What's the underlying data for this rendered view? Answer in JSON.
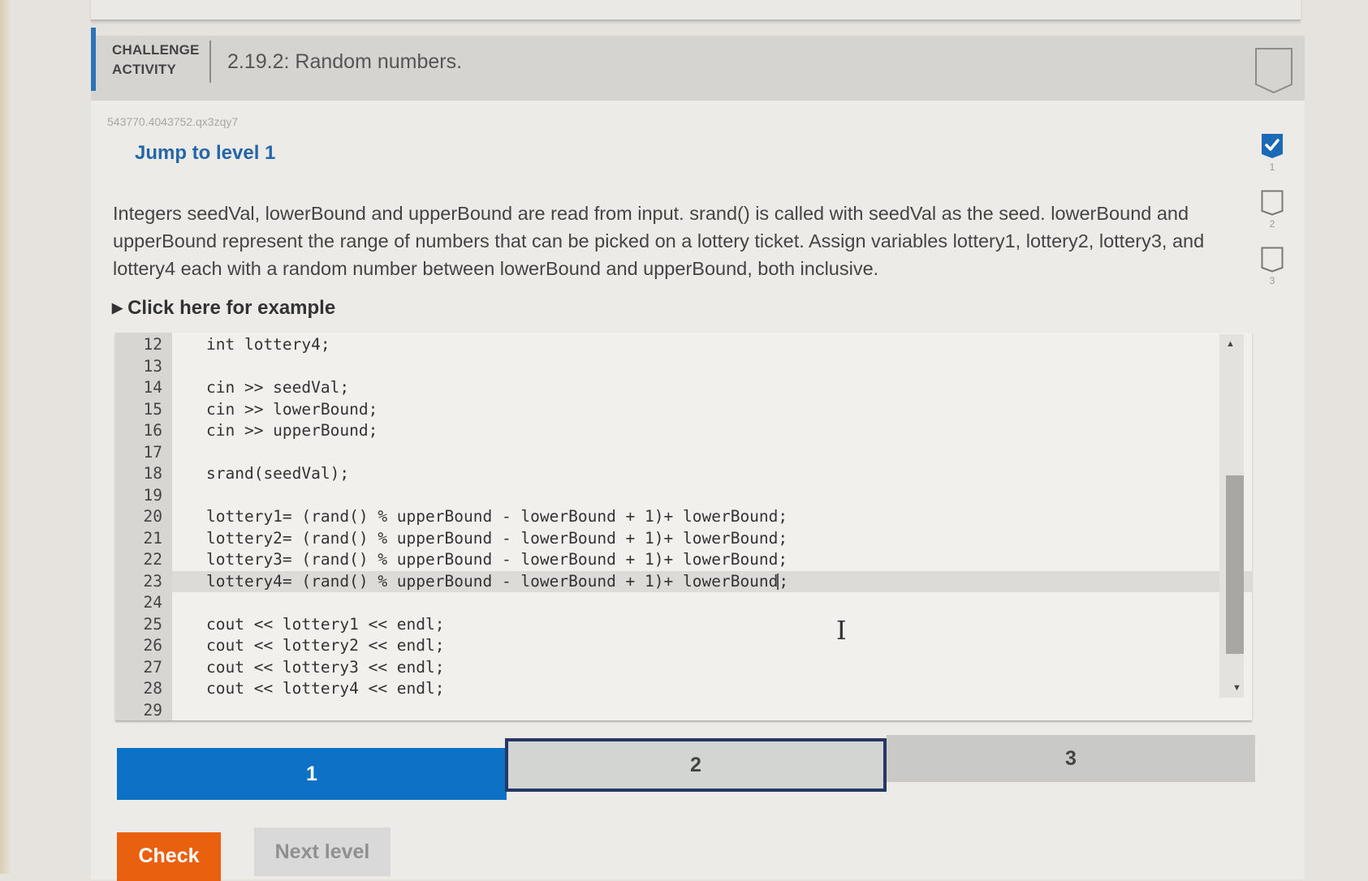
{
  "header": {
    "kind_line1": "CHALLENGE",
    "kind_line2": "ACTIVITY",
    "title": "2.19.2: Random numbers."
  },
  "activity_id": "543770.4043752.qx3zqy7",
  "jump_link": "Jump to level 1",
  "instructions": "Integers seedVal, lowerBound and upperBound are read from input. srand() is called with seedVal as the seed. lowerBound and upperBound represent the range of numbers that can be picked on a lottery ticket. Assign variables lottery1, lottery2, lottery3, and lottery4 each with a random number between lowerBound and upperBound, both inclusive.",
  "example_toggle": "Click here for example",
  "levels": [
    {
      "num": "1",
      "completed": true
    },
    {
      "num": "2",
      "completed": false
    },
    {
      "num": "3",
      "completed": false
    }
  ],
  "code": {
    "active_line": "23",
    "lines": [
      {
        "n": "12",
        "text": "int lottery4;"
      },
      {
        "n": "13",
        "text": ""
      },
      {
        "n": "14",
        "text": "cin >> seedVal;"
      },
      {
        "n": "15",
        "text": "cin >> lowerBound;"
      },
      {
        "n": "16",
        "text": "cin >> upperBound;"
      },
      {
        "n": "17",
        "text": ""
      },
      {
        "n": "18",
        "text": "srand(seedVal);"
      },
      {
        "n": "19",
        "text": ""
      },
      {
        "n": "20",
        "text": "lottery1= (rand() % upperBound - lowerBound + 1)+ lowerBound;"
      },
      {
        "n": "21",
        "text": "lottery2= (rand() % upperBound - lowerBound + 1)+ lowerBound;"
      },
      {
        "n": "22",
        "text": "lottery3= (rand() % upperBound - lowerBound + 1)+ lowerBound;"
      },
      {
        "n": "23",
        "text": "lottery4= (rand() % upperBound - lowerBound + 1)+ lowerBound;"
      },
      {
        "n": "24",
        "text": ""
      },
      {
        "n": "25",
        "text": "cout << lottery1 << endl;"
      },
      {
        "n": "26",
        "text": "cout << lottery2 << endl;"
      },
      {
        "n": "27",
        "text": "cout << lottery3 << endl;"
      },
      {
        "n": "28",
        "text": "cout << lottery4 << endl;"
      },
      {
        "n": "29",
        "text": ""
      }
    ]
  },
  "progress": {
    "segments": [
      {
        "label": "1",
        "state": "complete"
      },
      {
        "label": "2",
        "state": "current"
      },
      {
        "label": "3",
        "state": "locked"
      }
    ]
  },
  "buttons": {
    "check": "Check",
    "next_level": "Next level"
  },
  "colors": {
    "accent_blue": "#0d72c6",
    "check_orange": "#e9600e",
    "current_border": "#263763",
    "link_blue": "#2466a8"
  }
}
